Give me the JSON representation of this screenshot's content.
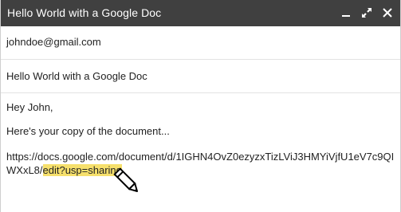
{
  "window": {
    "title": "Hello World with a Google Doc",
    "controls": [
      "minimize-icon",
      "expand-icon",
      "close-icon"
    ],
    "titlebar_color": "#404040"
  },
  "fields": {
    "to": "johndoe@gmail.com",
    "subject": "Hello World with a Google Doc"
  },
  "body": {
    "greeting": "Hey John,",
    "copy_line": "Here's your copy of the document...",
    "link_line1": "https://docs.google.com/document/d/1IGHN4OvZ0ezyzxTizLViJ3HMYiVjfU1eV7c9QI",
    "link_line2_prefix": "WXxL8/",
    "link_highlight": "edit?usp=sharing",
    "highlight_color": "#f6e06c"
  },
  "cursor": "pencil-icon"
}
